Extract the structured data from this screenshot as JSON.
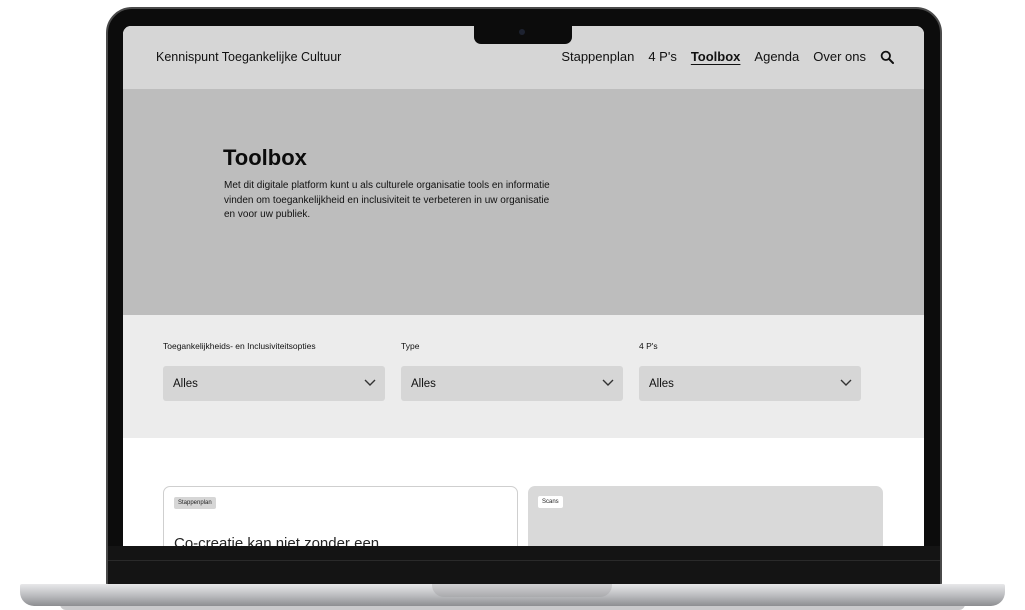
{
  "header": {
    "logo": "Kennispunt Toegankelijke Cultuur",
    "nav": [
      "Stappenplan",
      "4 P's",
      "Toolbox",
      "Agenda",
      "Over ons"
    ],
    "active_nav": "Toolbox",
    "search_icon": "search-icon"
  },
  "hero": {
    "title": "Toolbox",
    "description": "Met dit digitale platform kunt u als culturele organisatie tools en informatie vinden om toegankelijkheid en inclusiviteit te verbeteren in uw organisatie en voor uw publiek."
  },
  "filters": [
    {
      "label": "Toegankelijkheids- en Inclusiviteitsopties",
      "value": "Alles"
    },
    {
      "label": "Type",
      "value": "Alles"
    },
    {
      "label": "4 P's",
      "value": "Alles"
    }
  ],
  "cards": [
    {
      "tag": "Stappenplan",
      "title": "Co-creatie kan niet zonder een"
    },
    {
      "tag": "Scans",
      "title": ""
    }
  ],
  "colors": {
    "header_bg": "#d6d6d6",
    "hero_bg": "#bdbdbd",
    "filters_bg": "#ececec",
    "select_bg": "#d6d6d6"
  }
}
